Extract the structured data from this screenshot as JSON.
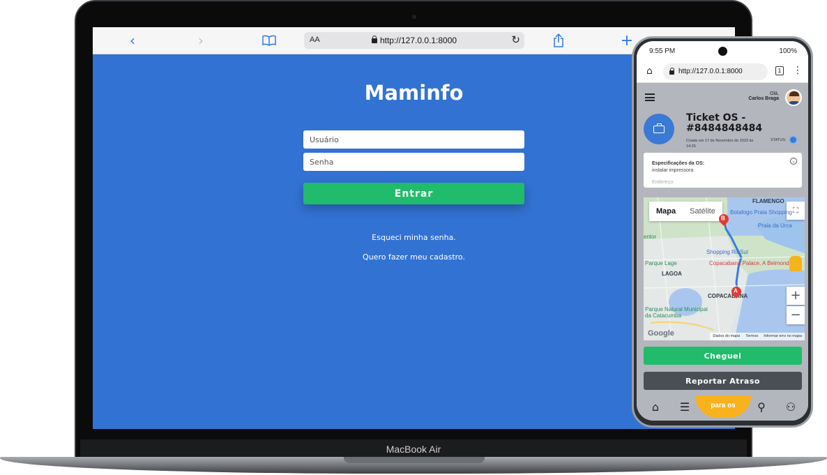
{
  "laptop": {
    "model_label": "MacBook Air",
    "browser": {
      "text_size_label": "AA",
      "url": "http://127.0.0.1:8000",
      "icons": [
        "back-icon",
        "forward-icon",
        "bookmarks-icon",
        "reload-icon",
        "share-icon",
        "new-tab-icon"
      ]
    },
    "login": {
      "title": "Maminfo",
      "username_placeholder": "Usuário",
      "password_placeholder": "Senha",
      "submit_label": "Entrar",
      "forgot_link": "Esqueci minha senha.",
      "register_link": "Quero fazer meu cadastro."
    },
    "colors": {
      "background": "#3272d2",
      "primary_button": "#21bb6c"
    }
  },
  "phone": {
    "status_bar": {
      "time": "9:55 PM",
      "battery": "100%"
    },
    "browser": {
      "url": "http://127.0.0.1:8000",
      "tab_count": "1"
    },
    "header": {
      "greeting": "Olá,",
      "user_name": "Carlos Braga"
    },
    "ticket": {
      "title_line1": "Ticket OS -",
      "title_line2": "#8484848484",
      "created": "Criada em 17 de Novembro de 2023 às 14:26",
      "status_label": "STATUS:"
    },
    "spec_card": {
      "title": "Especificações da OS:",
      "value": "instalar impressora",
      "next_field": "Endereço:"
    },
    "map": {
      "tab_map": "Mapa",
      "tab_satellite": "Satélite",
      "zoom_in": "+",
      "zoom_out": "−",
      "labels": [
        "FLAMENGO",
        "Botafogo Praia Shopping",
        "Praia da Urca",
        "Shopping RioSul",
        "Copacabana Palace, A Belmond",
        "LAGOA",
        "COPACABANA",
        "Parque Lage",
        "Parque Natural Municipal da Catacumba",
        "entor"
      ],
      "footer": [
        "Dados do mapa",
        "Termos",
        "Informar erro no mapa"
      ],
      "google": "Google"
    },
    "actions": {
      "arrived": "Cheguei",
      "report_delay": "Reportar Atraso"
    },
    "nav": {
      "fab_label": "para os",
      "icons": [
        "home-icon",
        "list-icon",
        "search-icon",
        "profile-settings-icon"
      ]
    }
  }
}
